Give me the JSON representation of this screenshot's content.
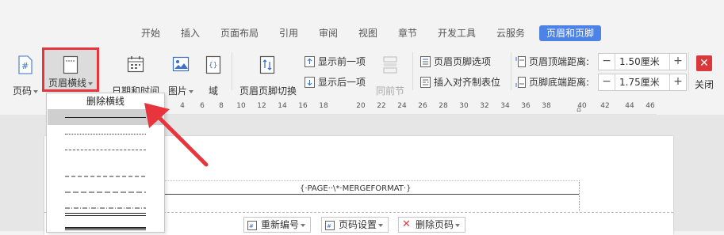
{
  "tabs": [
    "开始",
    "插入",
    "页面布局",
    "引用",
    "审阅",
    "视图",
    "章节",
    "开发工具",
    "云服务",
    "页眉和页脚"
  ],
  "active_tab": "页眉和页脚",
  "ribbon": {
    "page_number": "页码",
    "header_line": "页眉横线",
    "date_time": "日期和时间",
    "picture": "图片",
    "field": "域",
    "switch": "页眉页脚切换",
    "show_prev": "显示前一项",
    "show_next": "显示后一项",
    "same_as_prev": "同前节",
    "hf_options": "页眉页脚选项",
    "insert_tab": "插入对齐制表位",
    "header_top_label": "页眉顶端距离:",
    "header_top_value": "1.50厘米",
    "footer_bottom_label": "页脚底端距离:",
    "footer_bottom_value": "1.75厘米",
    "minus": "−",
    "plus": "+",
    "close": "关闭"
  },
  "ruler": [
    "4",
    "6",
    "8",
    "10",
    "12",
    "14",
    "16",
    "18",
    "20",
    "22",
    "24",
    "26",
    "28",
    "30",
    "32",
    "34",
    "36",
    "38",
    "40",
    "42",
    "44",
    "46"
  ],
  "document": {
    "header_field": "{·PAGE··\\*·MERGEFORMAT·}"
  },
  "footer_buttons": {
    "renumber": "重新编号",
    "page_settings": "页码设置",
    "delete_page": "删除页码"
  },
  "dropdown": {
    "title": "删除横线",
    "styles": [
      "single",
      "dotted",
      "dashed",
      "long-dash",
      "dash-dot",
      "double",
      "thick-thin",
      "thin-thick"
    ]
  },
  "colors": {
    "accent": "#4d82e6",
    "highlight": "#e8343c",
    "close": "#d9393b"
  }
}
